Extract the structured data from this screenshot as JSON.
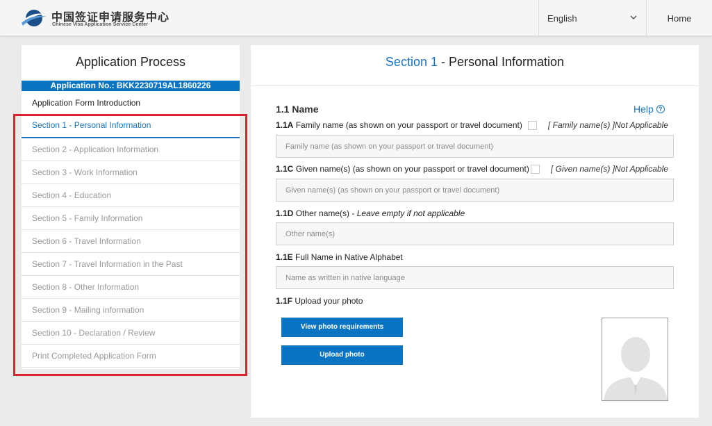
{
  "header": {
    "logo_cn": "中国签证申请服务中心",
    "logo_en": "Chinese Visa Application Service Center",
    "language": "English",
    "home_label": "Home"
  },
  "sidebar": {
    "title": "Application Process",
    "application_no": "Application No.: BKK2230719AL1860226",
    "intro": "Application Form Introduction",
    "items": [
      {
        "label": "Section 1 - Personal Information",
        "active": true
      },
      {
        "label": "Section 2 - Application Information",
        "active": false
      },
      {
        "label": "Section 3 - Work Information",
        "active": false
      },
      {
        "label": "Section 4 - Education",
        "active": false
      },
      {
        "label": "Section 5 - Family Information",
        "active": false
      },
      {
        "label": "Section 6 - Travel Information",
        "active": false
      },
      {
        "label": "Section 7 - Travel Information in the Past",
        "active": false
      },
      {
        "label": "Section 8 - Other Information",
        "active": false
      },
      {
        "label": "Section 9 - Mailing information",
        "active": false
      },
      {
        "label": "Section 10 - Declaration / Review",
        "active": false
      },
      {
        "label": "Print Completed Application Form",
        "active": false
      }
    ]
  },
  "main": {
    "section_number": "Section 1",
    "section_name": " - Personal Information",
    "subsection": "1.1 Name",
    "help": "Help",
    "help_icon": "question-circle-icon",
    "fields": {
      "family": {
        "code": "1.1A",
        "label": " Family name (as shown on your passport or travel document)",
        "na": "[ Family name(s) ]Not Applicable",
        "value": "",
        "placeholder": "Family name (as shown on your passport or travel document)"
      },
      "given": {
        "code": "1.1C",
        "label": " Given name(s) (as shown on your passport or travel document)",
        "na": "[ Given name(s) ]Not Applicable",
        "value": "",
        "placeholder": "Given name(s) (as shown on your passport or travel document)"
      },
      "other": {
        "code": "1.1D",
        "label": " Other name(s) - ",
        "hint": "Leave empty if not applicable",
        "value": "",
        "placeholder": "Other name(s)"
      },
      "native": {
        "code": "1.1E",
        "label": " Full Name in Native Alphabet",
        "value": "",
        "placeholder": "Name as written in native language"
      },
      "photo": {
        "code": "1.1F",
        "label": " Upload your photo"
      }
    },
    "buttons": {
      "requirements": "View photo requirements",
      "upload": "Upload photo"
    }
  },
  "colors": {
    "accent": "#0b74c2",
    "link": "#1a73c0",
    "highlight_frame": "#d9242f"
  }
}
